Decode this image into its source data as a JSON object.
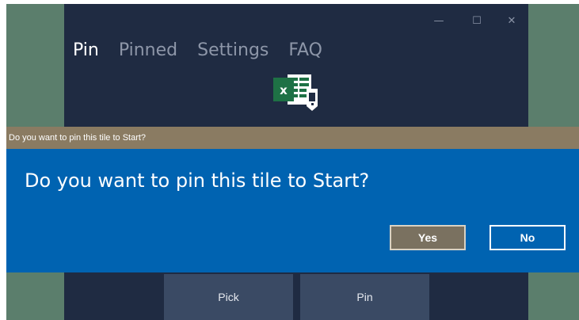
{
  "window": {
    "controls": {
      "minimize": "—",
      "maximize": "☐",
      "close": "✕"
    },
    "nav_tabs": [
      {
        "label": "Pin",
        "active": true
      },
      {
        "label": "Pinned",
        "active": false
      },
      {
        "label": "Settings",
        "active": false
      },
      {
        "label": "FAQ",
        "active": false
      }
    ],
    "tile_icon": "excel-pin-icon",
    "buttons": {
      "pick": "Pick",
      "pin": "Pin"
    }
  },
  "dialog": {
    "title": "Do you want to pin this tile to Start?",
    "message": "Do you want to pin this tile to Start?",
    "yes_label": "Yes",
    "no_label": "No"
  },
  "colors": {
    "desktop": "#5b7e6c",
    "app_background": "#1f2b42",
    "dialog_title_bar": "#8a7b62",
    "dialog_body": "#0063b1",
    "excel_green": "#1e7145"
  }
}
